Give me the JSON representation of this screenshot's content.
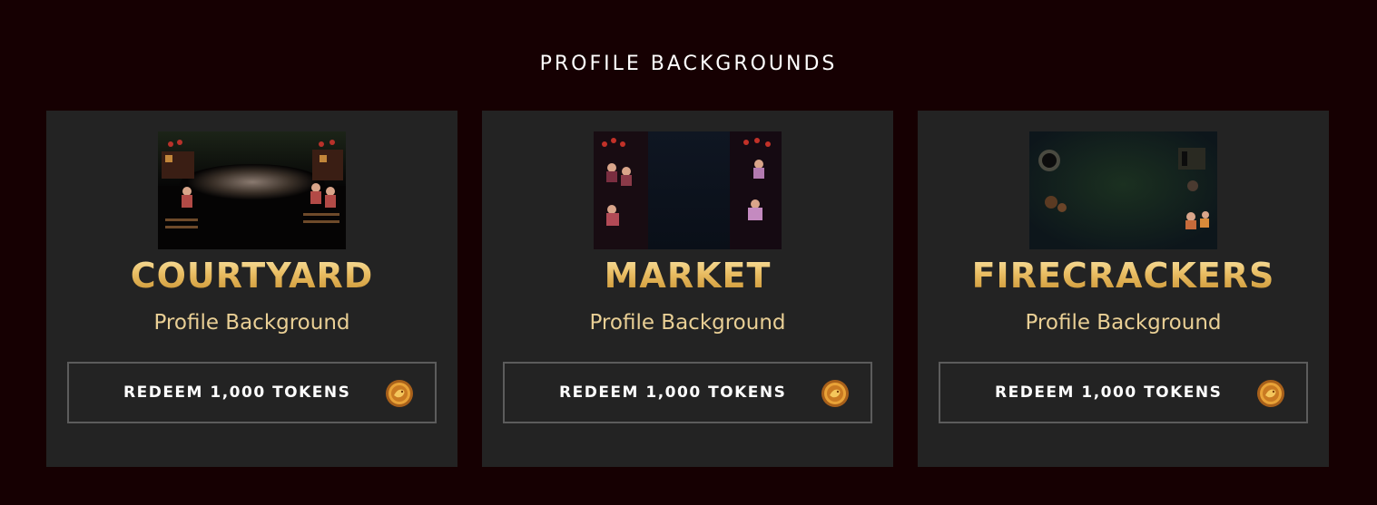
{
  "section": {
    "title": "PROFILE BACKGROUNDS"
  },
  "cards": [
    {
      "title": "COURTYARD",
      "subtitle": "Profile Background",
      "button_label": "REDEEM 1,000 TOKENS",
      "thumbnail_icon": "courtyard-background-thumbnail"
    },
    {
      "title": "MARKET",
      "subtitle": "Profile Background",
      "button_label": "REDEEM 1,000 TOKENS",
      "thumbnail_icon": "market-background-thumbnail"
    },
    {
      "title": "FIRECRACKERS",
      "subtitle": "Profile Background",
      "button_label": "REDEEM 1,000 TOKENS",
      "thumbnail_icon": "firecrackers-background-thumbnail"
    }
  ],
  "colors": {
    "page_background": "#160002",
    "card_background": "#232323",
    "title_gold": "#e9bd63",
    "subtitle_gold": "#e9cf95",
    "button_border": "#5c5c5c"
  },
  "token_icon": "token-coin-icon"
}
